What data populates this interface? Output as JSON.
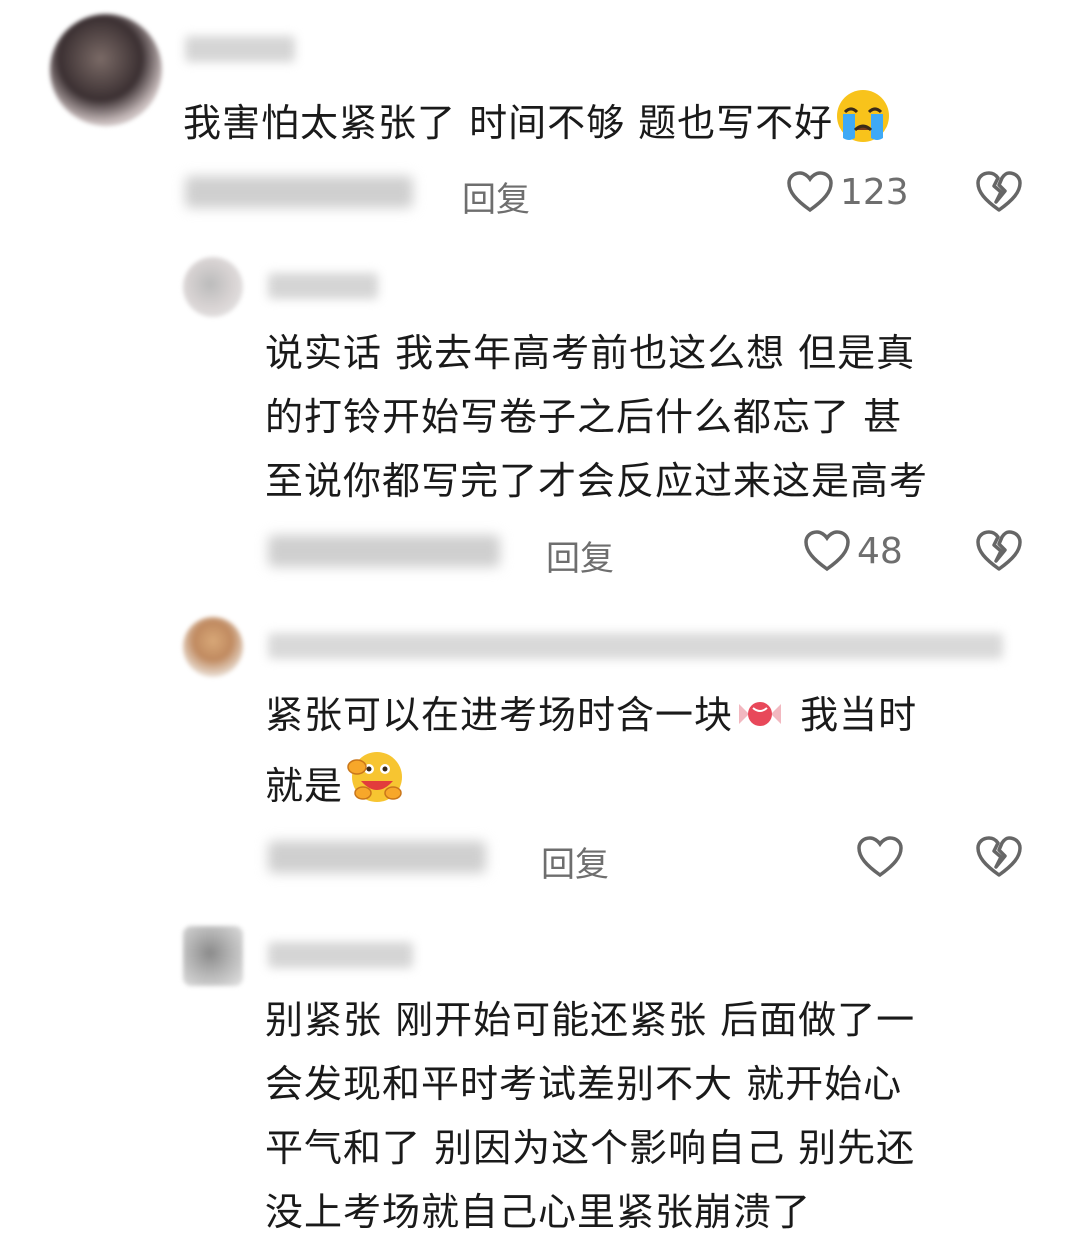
{
  "comments": [
    {
      "text": "我害怕太紧张了 时间不够 题也写不好",
      "reply_label": "回复",
      "like_count": "123",
      "emoji": "crying-face-emoji"
    },
    {
      "text_lines": [
        "说实话 我去年高考前也这么想 但是真",
        "的打铃开始写卷子之后什么都忘了 甚",
        "至说你都写完了才会反应过来这是高考"
      ],
      "reply_label": "回复",
      "like_count": "48"
    },
    {
      "text_line1_a": "紧张可以在进考场时含一块",
      "text_line1_b": " 我当时",
      "text_line2": "就是",
      "reply_label": "回复",
      "like_count": "",
      "emojis": [
        "candy-emoji",
        "hugging-face-emoji"
      ]
    },
    {
      "text_lines": [
        "别紧张 刚开始可能还紧张 后面做了一",
        "会发现和平时考试差别不大 就开始心",
        "平气和了 别因为这个影响自己 别先还",
        "没上考场就自己心里紧张崩溃了"
      ]
    }
  ],
  "colors": {
    "text": "#1a1a1a",
    "meta": "#6e6e6e",
    "background": "#ffffff"
  }
}
